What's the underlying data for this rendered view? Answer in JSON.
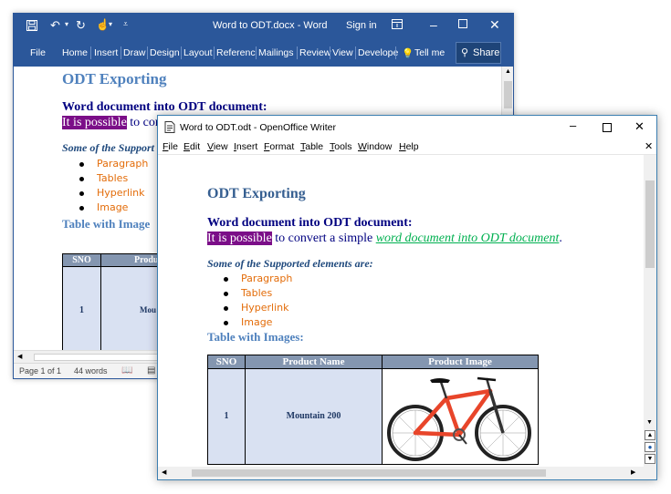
{
  "word": {
    "title": "Word to ODT.docx - Word",
    "sign_in": "Sign in",
    "tabs": [
      "File",
      "Home",
      "Insert",
      "Draw",
      "Design",
      "Layout",
      "Referenc",
      "Mailings",
      "Review",
      "View",
      "Develope"
    ],
    "tell_me": "Tell me",
    "share": "Share",
    "doc": {
      "heading": "ODT Exporting",
      "subheading": "Word document into ODT document:",
      "highlight": "It is possible",
      "text_after": " to conv",
      "supported": "Some of the Support",
      "bullets": [
        "Paragraph",
        "Tables",
        "Hyperlink",
        "Image"
      ],
      "table_heading": "Table with Image",
      "table_headers": [
        "SNO",
        "Produ"
      ],
      "row_sno": "1",
      "row_product": "Mou"
    },
    "status": {
      "page": "Page 1 of 1",
      "words": "44 words"
    }
  },
  "oo": {
    "title": "Word to ODT.odt - OpenOffice Writer",
    "menu": [
      {
        "label": "File",
        "u": "F",
        "rest": "ile"
      },
      {
        "label": "Edit",
        "u": "E",
        "rest": "dit"
      },
      {
        "label": "View",
        "u": "V",
        "rest": "iew"
      },
      {
        "label": "Insert",
        "u": "I",
        "rest": "nsert"
      },
      {
        "label": "Format",
        "u": "F",
        "rest": "ormat"
      },
      {
        "label": "Table",
        "u": "T",
        "rest": "able"
      },
      {
        "label": "Tools",
        "u": "T",
        "rest": "ools"
      },
      {
        "label": "Window",
        "u": "W",
        "rest": "indow"
      },
      {
        "label": "Help",
        "u": "H",
        "rest": "elp"
      }
    ],
    "doc": {
      "heading": "ODT Exporting",
      "subheading": "Word document into ODT document:",
      "highlight": "It is possible",
      "text_mid": " to convert a simple ",
      "link": "word document into ODT document",
      "period": ".",
      "supported": "Some of the Supported elements are:",
      "bullets": [
        "Paragraph",
        "Tables",
        "Hyperlink",
        "Image"
      ],
      "table_heading": "Table with Images:",
      "table_headers": [
        "SNO",
        "Product Name",
        "Product Image"
      ],
      "row_sno": "1",
      "row_product": "Mountain 200"
    }
  },
  "colors": {
    "word_blue": "#2b579a",
    "heading": "#4f81bd",
    "navy": "#000080",
    "highlight": "#7b0e88",
    "bullet": "#e36c09",
    "link": "#00b050",
    "table_header": "#8496b0",
    "table_cell": "#d9e1f2"
  }
}
